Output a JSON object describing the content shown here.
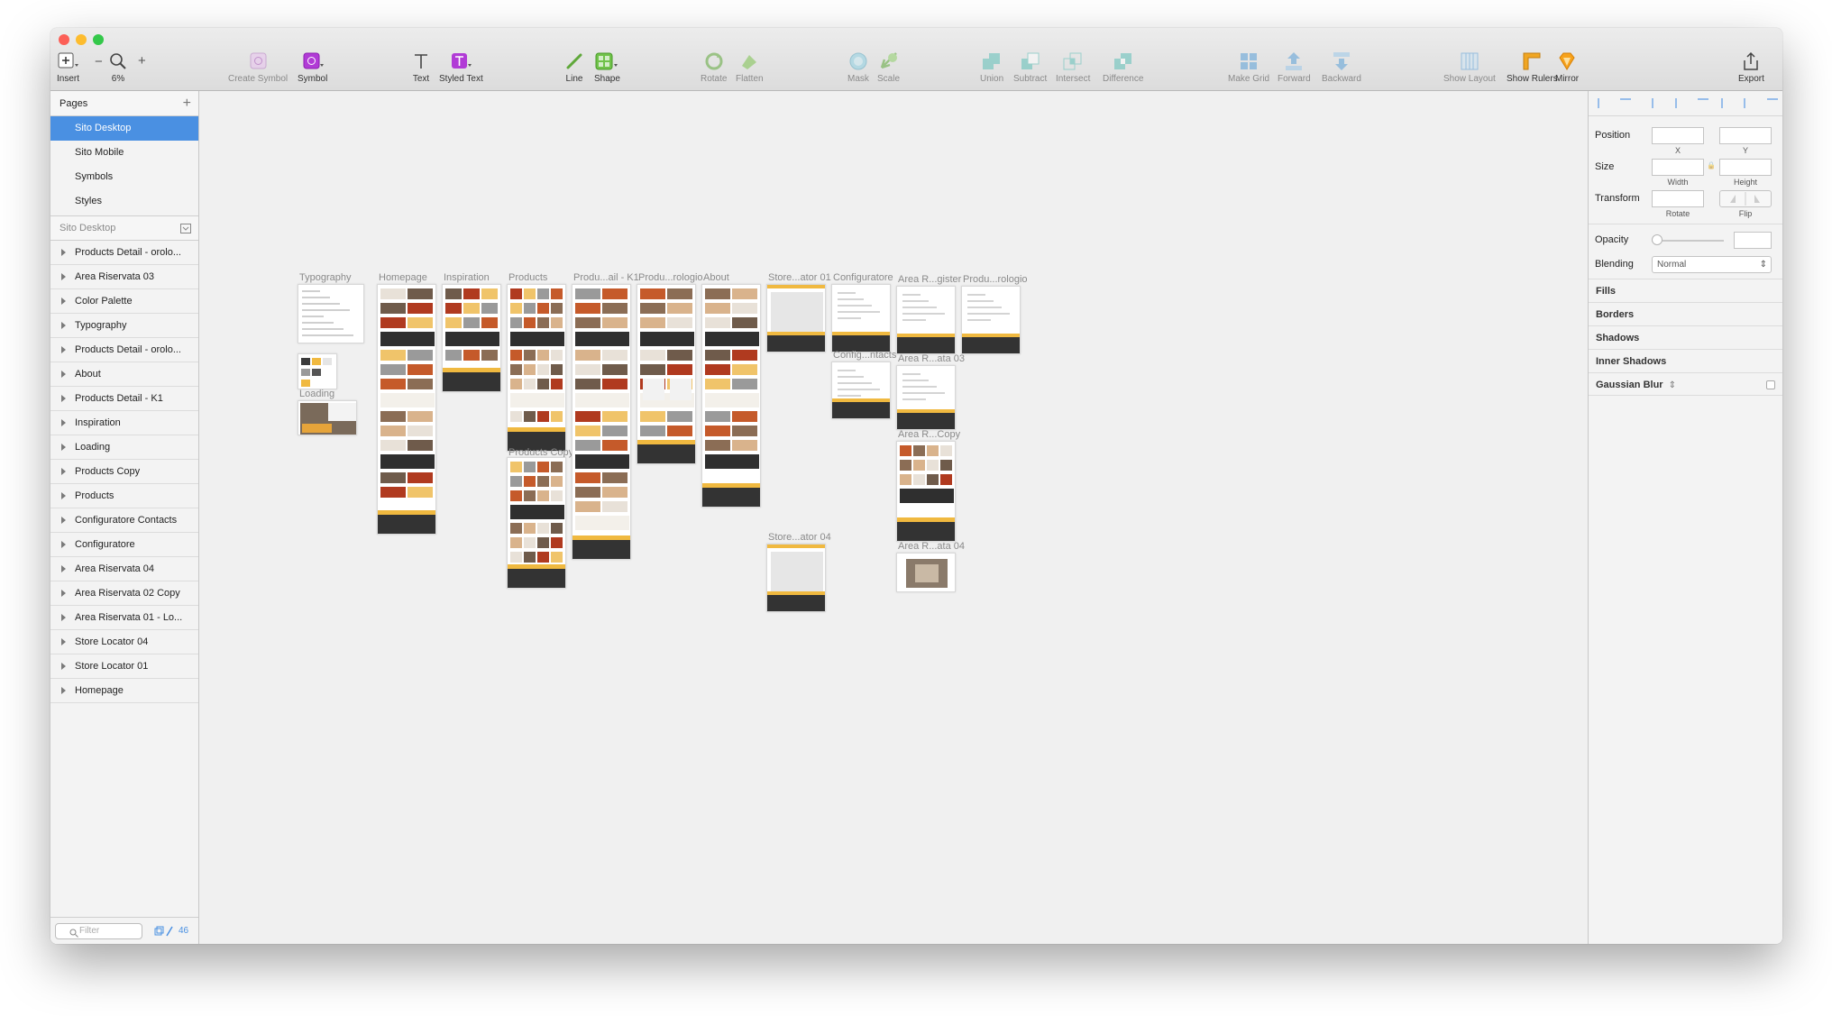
{
  "window": {
    "traffic_lights": [
      "#fc5f57",
      "#fdbc2e",
      "#34c84a"
    ]
  },
  "toolbar": {
    "insert": "Insert",
    "zoom": "6%",
    "create_symbol": "Create Symbol",
    "symbol": "Symbol",
    "text": "Text",
    "styled_text": "Styled Text",
    "line": "Line",
    "shape": "Shape",
    "rotate": "Rotate",
    "flatten": "Flatten",
    "mask": "Mask",
    "scale": "Scale",
    "union": "Union",
    "subtract": "Subtract",
    "intersect": "Intersect",
    "difference": "Difference",
    "make_grid": "Make Grid",
    "forward": "Forward",
    "backward": "Backward",
    "show_layout": "Show Layout",
    "show_rulers": "Show Rulers",
    "mirror": "Mirror",
    "export": "Export",
    "zoom_minus": "−",
    "zoom_plus": "+"
  },
  "pages": {
    "title": "Pages",
    "add": "+",
    "items": [
      "Sito Desktop",
      "Sito Mobile",
      "Symbols",
      "Styles"
    ],
    "selected": "Sito Desktop"
  },
  "layers": {
    "title": "Sito Desktop",
    "items": [
      "Products Detail - orolo...",
      "Area Riservata 03",
      "Color Palette",
      "Typography",
      "Products Detail - orolo...",
      "About",
      "Products Detail -  K1",
      "Inspiration",
      "Loading",
      "Products Copy",
      "Products",
      "Configuratore Contacts",
      "Configuratore",
      "Area Riservata 04",
      "Area Riservata 02 Copy",
      "Area Riservata 01 - Lo...",
      "Store Locator 04",
      "Store Locator 01",
      "Homepage"
    ]
  },
  "filter": {
    "placeholder": "Filter",
    "count": "46"
  },
  "artboards": [
    {
      "label": "Typography",
      "style": "text"
    },
    {
      "label": "",
      "style": "swatch"
    },
    {
      "label": "Loading",
      "style": "photo"
    },
    {
      "label": "Homepage",
      "style": "long"
    },
    {
      "label": "Inspiration",
      "style": "gallery"
    },
    {
      "label": "Products",
      "style": "grid"
    },
    {
      "label": "Products Copy",
      "style": "grid"
    },
    {
      "label": "Produ...ail -  K1",
      "style": "shelf"
    },
    {
      "label": "Produ...rologio",
      "style": "clock"
    },
    {
      "label": "About",
      "style": "about"
    },
    {
      "label": "Store...ator 01",
      "style": "map"
    },
    {
      "label": "Store...ator 04",
      "style": "map"
    },
    {
      "label": "Configuratore",
      "style": "form"
    },
    {
      "label": "Config...ntacts",
      "style": "form"
    },
    {
      "label": "Area R...gister",
      "style": "form"
    },
    {
      "label": "Area R...ata 03",
      "style": "form"
    },
    {
      "label": "Area R...Copy",
      "style": "grid"
    },
    {
      "label": "Area R...ata 04",
      "style": "chair"
    },
    {
      "label": "Produ...rologio",
      "style": "plain"
    }
  ],
  "inspector": {
    "position": "Position",
    "x": "X",
    "y": "Y",
    "size": "Size",
    "width": "Width",
    "height": "Height",
    "transform": "Transform",
    "rotate": "Rotate",
    "flip": "Flip",
    "opacity": "Opacity",
    "blending": "Blending",
    "blending_value": "Normal",
    "sections": [
      "Fills",
      "Borders",
      "Shadows",
      "Inner Shadows",
      "Gaussian Blur"
    ],
    "lock": "🔒",
    "stepper": "⇕"
  }
}
